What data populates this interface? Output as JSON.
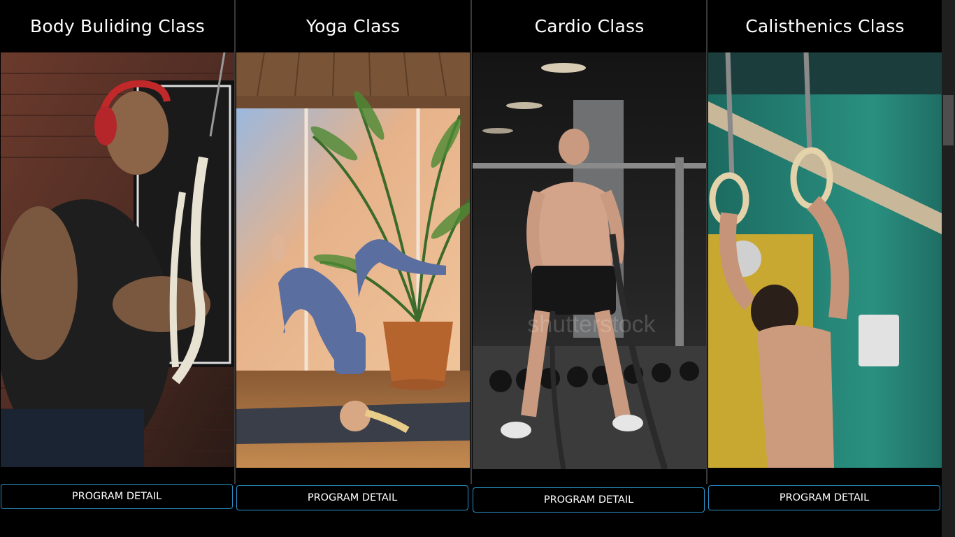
{
  "classes": [
    {
      "title": "Body Buliding Class",
      "button": "PROGRAM DETAIL",
      "image_subject": "bodybuilder pulling rope"
    },
    {
      "title": "Yoga Class",
      "button": "PROGRAM DETAIL",
      "image_subject": "yoga headstand pose by plant"
    },
    {
      "title": "Cardio Class",
      "button": "PROGRAM DETAIL",
      "image_subject": "battle rope workout in gym",
      "watermark": "shutterstock"
    },
    {
      "title": "Calisthenics Class",
      "button": "PROGRAM DETAIL",
      "image_subject": "gymnastic rings pull-up"
    }
  ],
  "colors": {
    "background": "#000000",
    "button_border": "#2a93c9",
    "text": "#ffffff"
  }
}
